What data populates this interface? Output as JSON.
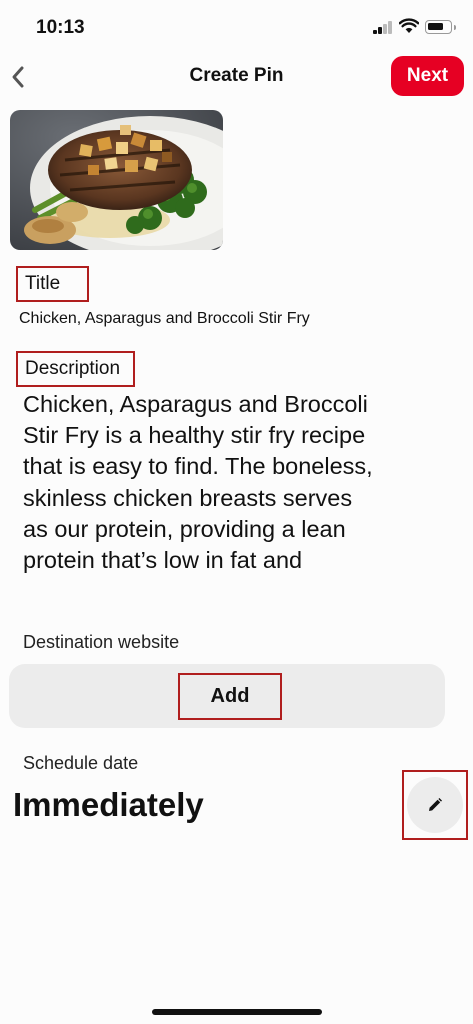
{
  "status_bar": {
    "time": "10:13",
    "icons": [
      "cellular-signal-icon",
      "wifi-icon",
      "battery-icon"
    ]
  },
  "header": {
    "back_icon": "chevron-left-icon",
    "title": "Create Pin",
    "next_label": "Next"
  },
  "pin": {
    "image": "food photo: grilled chicken with asparagus and broccoli"
  },
  "title_field": {
    "label": "Title",
    "value": "Chicken, Asparagus and Broccoli Stir Fry"
  },
  "description_field": {
    "label": "Description",
    "value": "Chicken, Asparagus and Broccoli Stir Fry is a healthy stir fry recipe that is easy to find. The boneless, skinless chicken breasts serves as our protein, providing a lean protein that’s low in fat and"
  },
  "destination": {
    "label": "Destination website",
    "add_label": "Add"
  },
  "schedule": {
    "label": "Schedule date",
    "value": "Immediately",
    "edit_icon": "pencil-icon"
  },
  "colors": {
    "accent": "#e60023",
    "annotation_outline": "#b01e1e",
    "button_bg": "#ececec"
  }
}
